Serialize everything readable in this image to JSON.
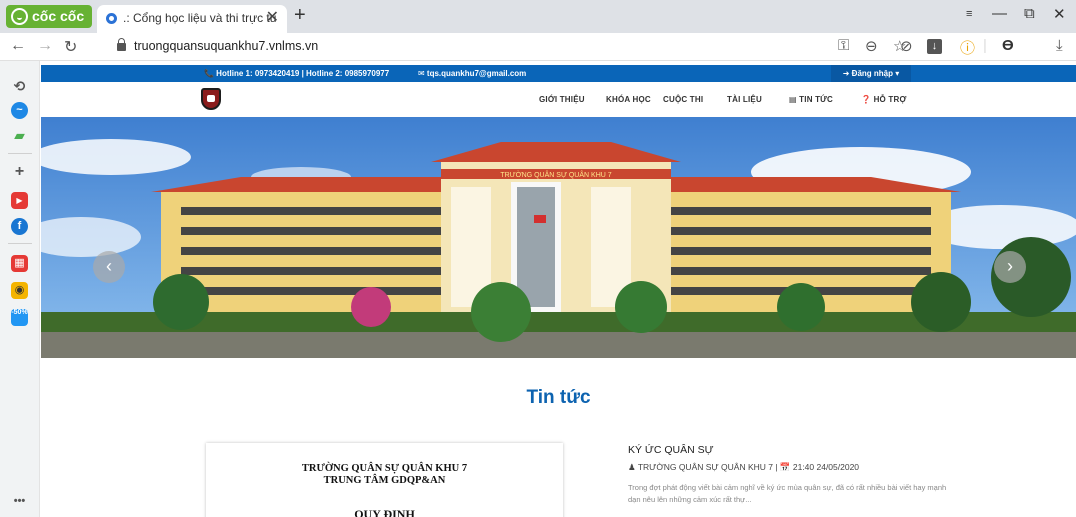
{
  "browser": {
    "brand": "cốc cốc",
    "tab_title": ".: Cổng học liệu và thi trực tu",
    "tab_close": "✕",
    "new_tab": "+",
    "url": "truongquansuquankhu7.vnlms.vn",
    "win_controls": [
      "≡",
      "—",
      "⧉",
      "✕"
    ],
    "sidebar_more": "•••"
  },
  "topbar": {
    "hotline": "📞 Hotline 1: 0973420419 | Hotline 2: 0985970977",
    "email": "✉ tqs.quankhu7@gmail.com",
    "login": "➜ Đăng nhập ▾"
  },
  "menu": {
    "items": [
      {
        "label": "GIỚI THIỆU"
      },
      {
        "label": "KHÓA HỌC"
      },
      {
        "label": "CUỘC THI"
      },
      {
        "label": "TÀI LIỆU"
      },
      {
        "label": "▤ TIN TỨC"
      },
      {
        "label": "❓ HỖ TRỢ"
      }
    ]
  },
  "hero": {
    "building_sign": "TRƯỜNG QUÂN SỰ QUÂN KHU 7",
    "prev_arrow": "‹",
    "next_arrow": "›"
  },
  "news": {
    "heading": "Tin tức",
    "doc_line1": "TRƯỜNG QUÂN SỰ QUÂN KHU 7",
    "doc_line2": "TRUNG TÂM GDQP&AN",
    "doc_line3": "QUY ĐỊNH",
    "article_title": "KÝ ỨC QUÂN SỰ",
    "article_meta": "♟ TRƯỜNG QUÂN SỰ QUÂN KHU 7   |   📅 21:40 24/05/2020",
    "article_desc": "Trong đợt phát động viết bài cảm nghĩ về ký ức mùa quân sự, đã có rất nhiều bài viết hay mạnh dạn nêu lên những cảm xúc rất thự..."
  }
}
